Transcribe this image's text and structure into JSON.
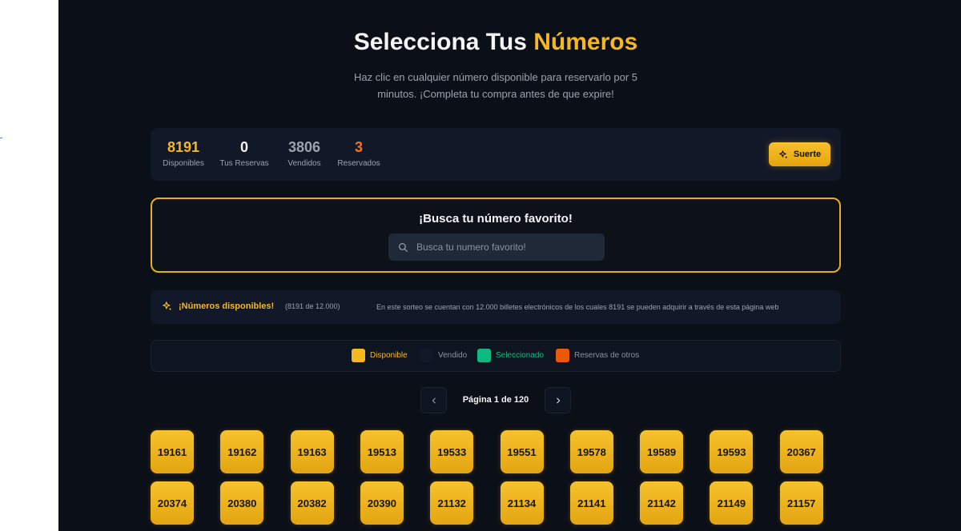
{
  "hero": {
    "title_prefix": "Selecciona Tus",
    "title_accent": "Números",
    "subtitle": "Haz clic en cualquier número disponible para reservarlo por 5 minutos. ¡Completa tu compra antes de que expire!"
  },
  "stats": [
    {
      "value": "8191",
      "label": "Disponibles",
      "color": "#f5b722"
    },
    {
      "value": "0",
      "label": "Tus Reservas",
      "color": "#f3f4f6"
    },
    {
      "value": "3806",
      "label": "Vendidos",
      "color": "#9ca3af"
    },
    {
      "value": "3",
      "label": "Reservados",
      "color": "#f97316"
    }
  ],
  "luck_button": {
    "label": "Suerte",
    "icon": "sparkles-icon"
  },
  "search": {
    "title": "¡Busca tu número favorito!",
    "placeholder": "Busca tu numero favorito!",
    "value": ""
  },
  "info": {
    "title": "¡Números disponibles!",
    "count": "(8191 de 12.000)",
    "description": "En este sorteo se cuentan con 12.000 billetes electrónicos de los cuales 8191 se pueden adquirir a través de esta página web"
  },
  "legend": [
    {
      "label": "Disponible",
      "color": "#f5b722",
      "text_color": "#f5b722"
    },
    {
      "label": "Vendido",
      "color": "#111827",
      "text_color": "#8b93a1"
    },
    {
      "label": "Seleccionado",
      "color": "#10b981",
      "text_color": "#10b981"
    },
    {
      "label": "Reservas de otros",
      "color": "#ea580c",
      "text_color": "#8b93a1"
    }
  ],
  "pagination": {
    "label": "Página 1 de 120",
    "prev_icon": "chevron-left-icon",
    "next_icon": "chevron-right-icon"
  },
  "tickets": [
    "19161",
    "19162",
    "19163",
    "19513",
    "19533",
    "19551",
    "19578",
    "19589",
    "19593",
    "20367",
    "20374",
    "20380",
    "20382",
    "20390",
    "21132",
    "21134",
    "21141",
    "21142",
    "21149",
    "21157"
  ],
  "colors": {
    "accent": "#f5b722",
    "background": "#0b0f17",
    "panel": "#111827"
  }
}
